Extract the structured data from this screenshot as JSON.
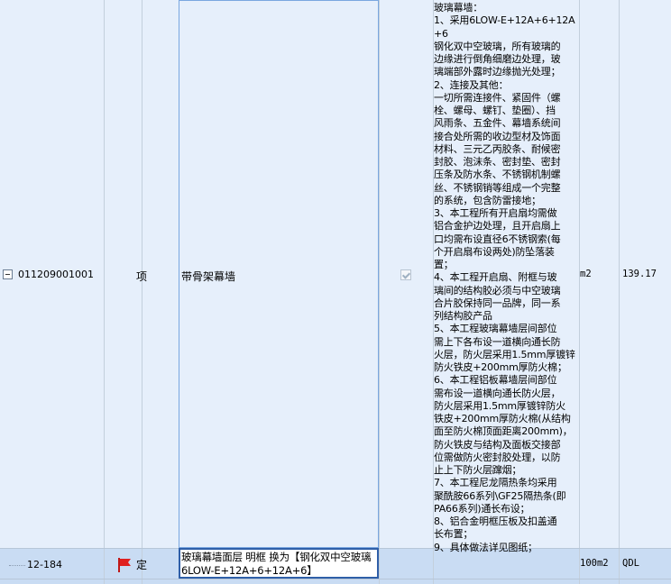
{
  "main_row": {
    "code": "011209001001",
    "type": "项",
    "name": "带骨架幕墙",
    "checked": true,
    "description_lines": [
      "玻璃幕墙：",
      "1、采用6LOW-E+12A+6+12A+6",
      "钢化双中空玻璃，所有玻璃的",
      "边缘进行倒角细磨边处理，玻",
      "璃端部外露时边缘抛光处理；",
      "2、连接及其他：",
      "一切所需连接件、紧固件（螺",
      "栓、螺母、螺钉、垫圈）、挡",
      "风雨条、五金件、幕墙系统间",
      "接合处所需的收边型材及饰面",
      "材料、三元乙丙胶条、耐候密",
      "封胶、泡沫条、密封垫、密封",
      "压条及防水条、不锈钢机制螺",
      "丝、不锈钢销等组成一个完整",
      "的系统，包含防雷接地；",
      "3、本工程所有开启扇均需做",
      "铝合金护边处理，且开启扇上",
      "口均需布设直径6不锈钢索(每",
      "个开启扇布设两处)防坠落装",
      "置；",
      "4、本工程开启扇、附框与玻",
      "璃间的结构胶必须与中空玻璃",
      "合片胶保持同一品牌，同一系",
      "列结构胶产品",
      "5、本工程玻璃幕墙层间部位",
      "需上下各布设一道横向通长防",
      "火层，防火层采用1.5mm厚镀锌",
      "防火铁皮+200mm厚防火棉；",
      "6、本工程铝板幕墙层间部位",
      "需布设一道横向通长防火层，",
      "防火层采用1.5mm厚镀锌防火",
      "铁皮+200mm厚防火棉(从结构",
      "面至防火棉顶面距离200mm)，",
      "防火铁皮与结构及面板交接部",
      "位需做防火密封胶处理，以防",
      "止上下防火层蹿烟；",
      "7、本工程尼龙隔热条均采用",
      "聚酰胺66系列\\GF25隔热条(即",
      "PA66系列)通长布设；",
      "8、铝合金明框压板及扣盖通",
      "长布置；",
      "9、具体做法详见图纸；"
    ],
    "unit": "m2",
    "quantity": "139.17"
  },
  "sub_row": {
    "code": "12-184",
    "flag_icon": "red-flag-icon",
    "type": "定",
    "name": "玻璃幕墙面层 明框  换为【钢化双中空玻璃6LOW-E+12A+6+12A+6】",
    "unit": "100m2",
    "quantity": "QDL"
  },
  "colors": {
    "row_bg": "#e6effb",
    "selected_row_bg": "#c9dcf3",
    "edit_border": "#2f5fa8",
    "flag": "#e02020"
  }
}
